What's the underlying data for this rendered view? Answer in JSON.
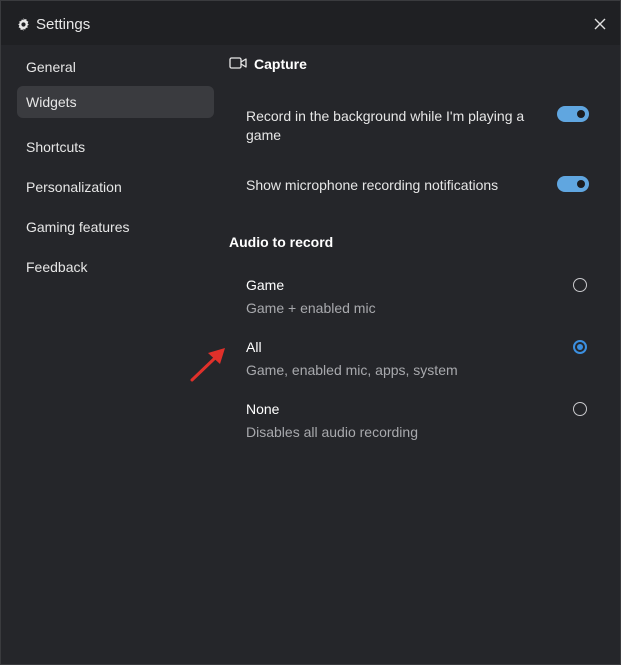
{
  "window": {
    "title": "Settings"
  },
  "sidebar": {
    "items": [
      {
        "label": "General",
        "active": false
      },
      {
        "label": "Widgets",
        "active": true
      },
      {
        "label": "Shortcuts",
        "active": false
      },
      {
        "label": "Personalization",
        "active": false
      },
      {
        "label": "Gaming features",
        "active": false
      },
      {
        "label": "Feedback",
        "active": false
      }
    ]
  },
  "capture": {
    "heading": "Capture",
    "settings": [
      {
        "label": "Record in the background while I'm playing a game",
        "enabled": true
      },
      {
        "label": "Show microphone recording notifications",
        "enabled": true
      }
    ]
  },
  "audio": {
    "heading": "Audio to record",
    "options": [
      {
        "title": "Game",
        "description": "Game + enabled mic",
        "selected": false
      },
      {
        "title": "All",
        "description": "Game, enabled mic, apps, system",
        "selected": true
      },
      {
        "title": "None",
        "description": "Disables all audio recording",
        "selected": false
      }
    ]
  },
  "colors": {
    "accent": "#3b8fe0",
    "toggle_on": "#60a6e0",
    "annotation_arrow": "#e0302a"
  }
}
